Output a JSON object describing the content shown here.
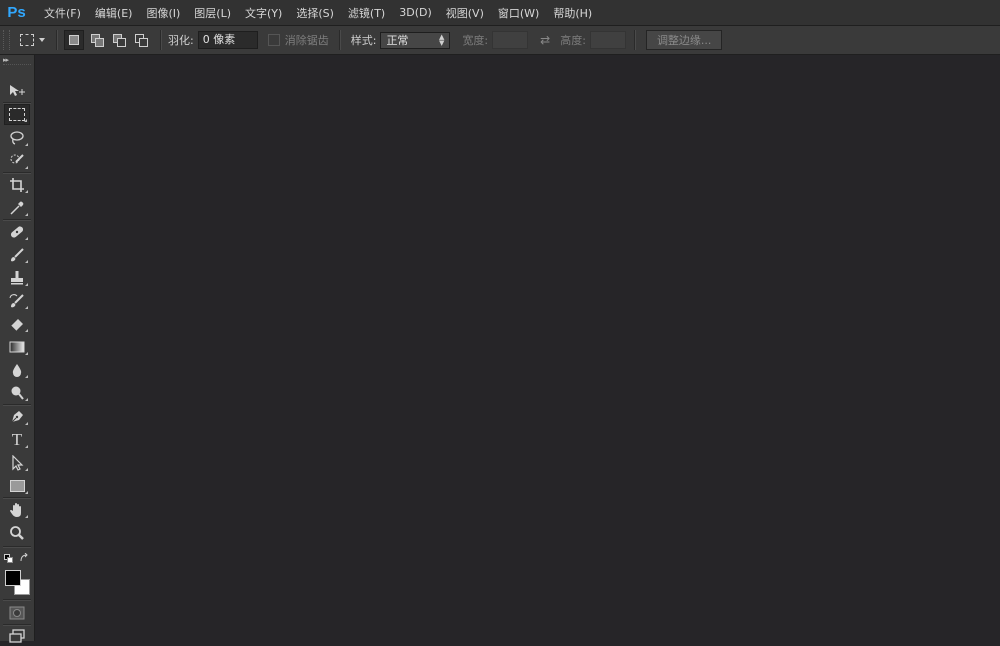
{
  "app": {
    "logo": "Ps",
    "brand_color": "#31a8ff"
  },
  "menu": [
    "文件(F)",
    "编辑(E)",
    "图像(I)",
    "图层(L)",
    "文字(Y)",
    "选择(S)",
    "滤镜(T)",
    "3D(D)",
    "视图(V)",
    "窗口(W)",
    "帮助(H)"
  ],
  "options": {
    "feather_label": "羽化:",
    "feather_value": "0 像素",
    "antialias_label": "消除锯齿",
    "style_label": "样式:",
    "style_value": "正常",
    "width_label": "宽度:",
    "height_label": "高度:",
    "swap_icon": "⇄",
    "refine_edge_label": "调整边缘..."
  },
  "tools": {
    "collapse_glyph": "▸▸",
    "items": [
      "move-tool",
      "rectangular-marquee-tool",
      "lasso-tool",
      "quick-selection-tool",
      "crop-tool",
      "eyedropper-tool",
      "spot-healing-brush-tool",
      "brush-tool",
      "clone-stamp-tool",
      "history-brush-tool",
      "eraser-tool",
      "gradient-tool",
      "blur-tool",
      "dodge-tool",
      "pen-tool",
      "type-tool",
      "path-selection-tool",
      "rectangle-tool",
      "hand-tool",
      "zoom-tool"
    ],
    "active": "rectangular-marquee-tool"
  },
  "colors": {
    "foreground": "#000000",
    "background": "#ffffff",
    "canvas_bg": "#262528",
    "panel_bg": "#3a3a3a"
  }
}
